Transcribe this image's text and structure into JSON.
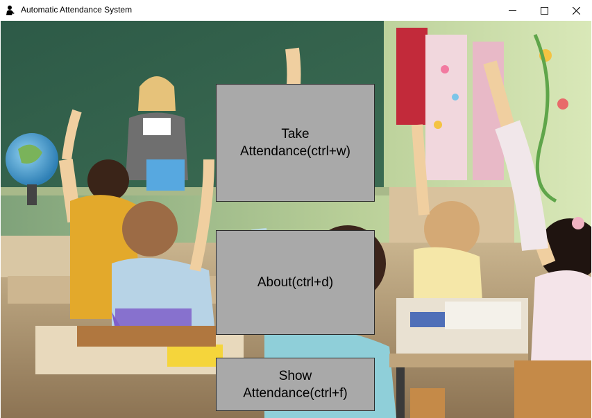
{
  "window": {
    "title": "Automatic Attendance System",
    "app_icon": "person-icon",
    "controls": {
      "minimize_icon": "minimize-icon",
      "maximize_icon": "maximize-icon",
      "close_icon": "close-icon"
    }
  },
  "background": {
    "image": "classroom-photo"
  },
  "buttons": {
    "take_attendance": {
      "line1": "Take",
      "line2": "Attendance(ctrl+w)"
    },
    "about": {
      "label": "About(ctrl+d)"
    },
    "show_attendance": {
      "line1": "Show",
      "line2": "Attendance(ctrl+f)"
    }
  },
  "colors": {
    "button_bg": "#a9a9a9",
    "button_border": "#2b2b2b",
    "chalkboard": "#2f5a45",
    "wall": "#cfe0b0"
  }
}
